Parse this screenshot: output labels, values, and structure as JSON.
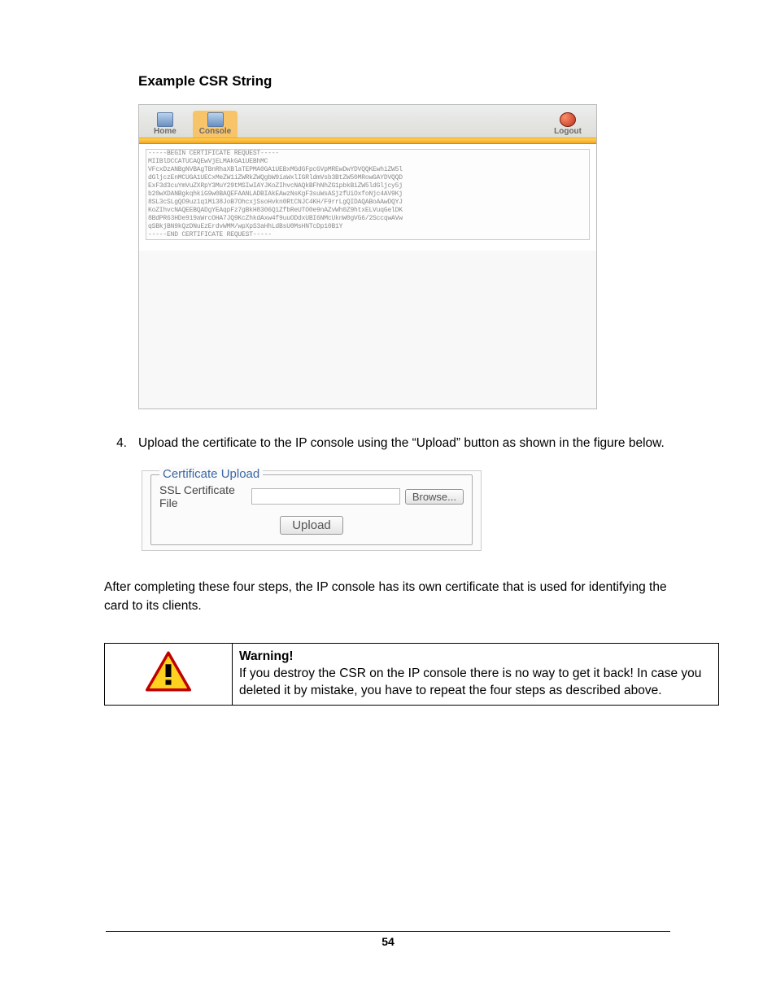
{
  "heading": "Example CSR String",
  "shot1": {
    "tabs": {
      "home": "Home",
      "console": "Console",
      "logout": "Logout"
    },
    "csr_text": "-----BEGIN CERTIFICATE REQUEST-----\nMIIBlDCCATUCAQEwVjELMAkGA1UEBhMC\nVFcxDzANBgNVBAgTBnRhaXBlaTEPMA0GA1UEBxMGdGFpcGVpMREwDwYDVQQKEwhiZW5l\ndGljczEnMCUGA1UECxMeZW1iZWRkZWQgbW9iaWxlIGRldmVsb3BtZW50MRowGAYDVQQD\nExF3d3cuYmVuZXRpY3MuY29tMSIwIAYJKoZIhvcNAQkBFhNhZG1pbkBiZW5ldGljcy5j\nb20wXDANBgkqhkiG9w0BAQEFAANLADBIAkEAwzNsKgF3suWsASjzfUiOxfoNjc4AV9Kj\n8SL3cSLgQO9uz1q1Mi38JoB7OhcxjSsoHvkn0RtCNJC4KH/F9rrLgQIDAQABoAAwDQYJ\nKoZIhvcNAQEEBQADgYEAqpFz7gBkH8306Q1ZfbReUTO0e9nAZvWh0Z9htxELVuqGelDK\n8BdPR63HDe919aWrcOHA7JQ9KcZhkdAxw4f9uuODdxUBI6NMcUknW0gVG6/2SccqwAVw\nqSBkjBN9kQzDNuEzErdvWMM/wpXpS3aHhLdBsU0MsHNTcDp10B1Y\n-----END CERTIFICATE REQUEST-----"
  },
  "step4": {
    "num": "4.",
    "text": "Upload the certificate to the IP console using the “Upload” button as shown in the figure below."
  },
  "shot2": {
    "legend": "Certificate Upload",
    "label": "SSL Certificate File",
    "file_value": "",
    "browse": "Browse...",
    "upload": "Upload"
  },
  "after_para": "After completing these four steps, the IP console has its own certificate that is used for identifying the card to its clients.",
  "warning": {
    "title": "Warning!",
    "text": "If you destroy the CSR on the IP console there is no way to get it back! In case you deleted it by mistake, you have to repeat the four steps as described above."
  },
  "page_number": "54"
}
